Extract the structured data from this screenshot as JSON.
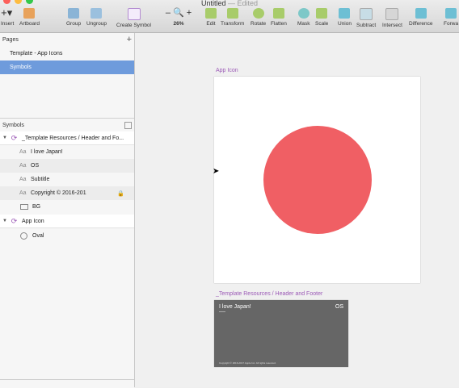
{
  "window": {
    "title": "Untitled",
    "status": "— Edited"
  },
  "toolbar": {
    "insert": "Insert",
    "artboard": "Artboard",
    "group": "Group",
    "ungroup": "Ungroup",
    "create_symbol": "Create Symbol",
    "zoom": "26%",
    "edit": "Edit",
    "transform": "Transform",
    "rotate": "Rotate",
    "flatten": "Flatten",
    "mask": "Mask",
    "scale": "Scale",
    "union": "Union",
    "subtract": "Subtract",
    "intersect": "Intersect",
    "difference": "Difference",
    "forward": "Forwa"
  },
  "pages": {
    "title": "Pages",
    "items": [
      {
        "label": "Template - App Icons"
      },
      {
        "label": "Symbols"
      }
    ]
  },
  "layers": {
    "title": "Symbols",
    "group1": "_Template Resources / Header and Fo...",
    "g1_items": [
      "I love Japan!",
      "OS",
      "Subtitle",
      "Copyright © 2016-201",
      "BG"
    ],
    "group2": "App Icon",
    "g2_items": [
      "Oval"
    ]
  },
  "canvas": {
    "app_icon_label": "App Icon",
    "hf_label": "_Template Resources / Header and Footer",
    "hf_title": "I love Japan!",
    "hf_os": "OS",
    "hf_footer": "Copyright © 2016-2017 Apple Inc. All rights reserved."
  },
  "colors": {
    "accent": "#6e9bdc",
    "symbol": "#9b59b6",
    "circle": "#f05f64"
  }
}
